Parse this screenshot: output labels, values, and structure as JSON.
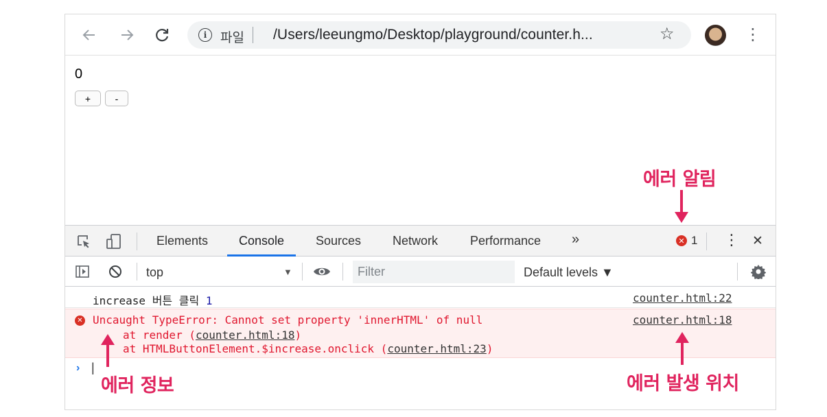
{
  "browser": {
    "nav_back": "←",
    "nav_forward": "→",
    "reload": "C",
    "info_icon": "i",
    "scheme_label": "파일",
    "url": "/Users/leeungmo/Desktop/playground/counter.h...",
    "bookmark": "☆",
    "menu": "⋮"
  },
  "page": {
    "counter_value": "0",
    "increase_label": "+",
    "decrease_label": "-"
  },
  "devtools": {
    "tabs": [
      "Elements",
      "Console",
      "Sources",
      "Network",
      "Performance"
    ],
    "more_tabs": "»",
    "active_tab": "Console",
    "error_count": "1",
    "kebab": "⋮",
    "close": "✕",
    "context": "top",
    "context_arrow": "▼",
    "filter_placeholder": "Filter",
    "levels": "Default levels ▼",
    "accent": "#1a73e8"
  },
  "console": {
    "log": {
      "text": "increase 버튼 클릭 ",
      "value": "1",
      "source": "counter.html:22"
    },
    "error": {
      "message": "Uncaught TypeError: Cannot set property 'innerHTML' of null",
      "source": "counter.html:18",
      "stack1_prefix": "at render (",
      "stack1_link": "counter.html:18",
      "stack1_suffix": ")",
      "stack2_prefix": "at HTMLButtonElement.$increase.onclick (",
      "stack2_link": "counter.html:23",
      "stack2_suffix": ")",
      "color": "#e0162e"
    },
    "prompt": "›",
    "cursor": "|"
  },
  "annotations": {
    "error_alert": "에러 알림",
    "error_info": "에러 정보",
    "error_location": "에러 발생 위치",
    "color": "#e0245e"
  }
}
